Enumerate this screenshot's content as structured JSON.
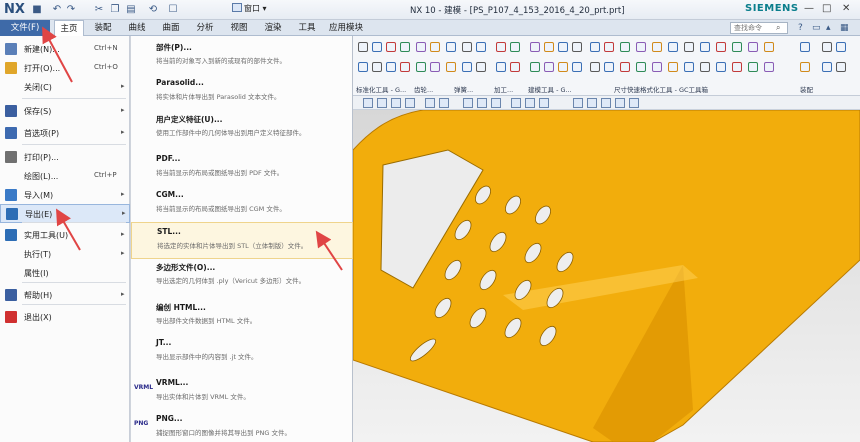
{
  "titlebar": {
    "logo": "NX",
    "window_menu": "窗口",
    "title": "NX 10 - 建模 - [PS_P107_4_153_2016_4_20_prt.prt]",
    "brand": "SIEMENS",
    "minimize": "—",
    "restore": "□",
    "close": "✕"
  },
  "tabs": {
    "file": "文件(F)",
    "items": [
      "主页",
      "装配",
      "曲线",
      "曲面",
      "分析",
      "视图",
      "渲染",
      "工具",
      "应用模块"
    ],
    "search_placeholder": "查找命令"
  },
  "ribbon": {
    "groups": [
      "标准化工具 - G...",
      "齿轮...",
      "弹簧...",
      "加工...",
      "建模工具 - G...",
      "尺寸快速格式化工具 - GC工具箱",
      "装配"
    ]
  },
  "left_menu": {
    "items": [
      {
        "label": "新建(N)...",
        "shortcut": "Ctrl+N",
        "icon": "new-file-icon"
      },
      {
        "label": "打开(O)...",
        "shortcut": "Ctrl+O",
        "icon": "open-folder-icon"
      },
      {
        "label": "关闭(C)",
        "shortcut": "",
        "icon": ""
      },
      {
        "label": "保存(S)",
        "shortcut": "",
        "icon": "save-icon"
      },
      {
        "label": "首选项(P)",
        "shortcut": "",
        "icon": "preferences-icon"
      },
      {
        "label": "打印(P)...",
        "shortcut": "",
        "icon": "print-icon"
      },
      {
        "label": "绘图(L)...",
        "shortcut": "Ctrl+P",
        "icon": ""
      },
      {
        "label": "导入(M)",
        "shortcut": "",
        "icon": "import-icon"
      },
      {
        "label": "导出(E)",
        "shortcut": "",
        "icon": "export-icon"
      },
      {
        "label": "实用工具(U)",
        "shortcut": "",
        "icon": "utilities-icon"
      },
      {
        "label": "执行(T)",
        "shortcut": "",
        "icon": ""
      },
      {
        "label": "属性(I)",
        "shortcut": "",
        "icon": ""
      },
      {
        "label": "帮助(H)",
        "shortcut": "",
        "icon": "help-icon"
      },
      {
        "label": "退出(X)",
        "shortcut": "",
        "icon": "exit-icon"
      }
    ]
  },
  "submenu": {
    "items": [
      {
        "title": "部件(P)...",
        "desc": "将当前的对象写入到新的或现有的部件文件。",
        "icon": ""
      },
      {
        "title": "Parasolid...",
        "desc": "将实体和片体导出到 Parasolid 文本文件。",
        "icon": ""
      },
      {
        "title": "用户定义特征(U)...",
        "desc": "使用工作部件中的几何体导出到用户定义特征部件。",
        "icon": ""
      },
      {
        "title": "PDF...",
        "desc": "将当前显示的布局或图纸导出到 PDF 文件。",
        "icon": ""
      },
      {
        "title": "CGM...",
        "desc": "将当前显示的布局或图纸导出到 CGM 文件。",
        "icon": ""
      },
      {
        "title": "STL...",
        "desc": "将选定的实体和片体导出到 STL（立体制版）文件。",
        "icon": ""
      },
      {
        "title": "多边形文件(O)...",
        "desc": "导出选定的几何体到 .ply（Vericut 多边形）文件。",
        "icon": ""
      },
      {
        "title": "编创 HTML...",
        "desc": "导出部件文件数据到 HTML 文件。",
        "icon": ""
      },
      {
        "title": "JT...",
        "desc": "导出显示部件中的内容到 .jt 文件。",
        "icon": ""
      },
      {
        "title": "VRML...",
        "desc": "导出实体和片体到 VRML 文件。",
        "icon": "VRML"
      },
      {
        "title": "PNG...",
        "desc": "捕捉图形窗口的图像并将其导出到 PNG 文件。",
        "icon": "PNG"
      }
    ]
  },
  "colors": {
    "accent": "#3e6aa8",
    "model": "#f2ad0c",
    "annotation_arrow": "#e04545"
  }
}
